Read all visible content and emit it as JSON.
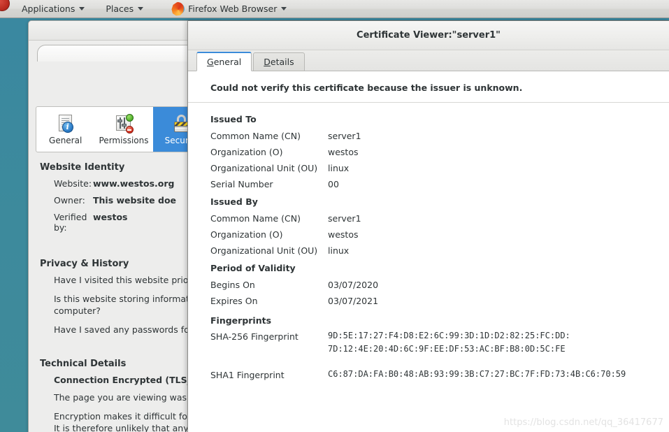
{
  "panel": {
    "applications": "Applications",
    "places": "Places",
    "firefox": "Firefox Web Browser"
  },
  "page_info": {
    "toolbar": [
      {
        "label": "General",
        "icon": "document-info-icon",
        "selected": false
      },
      {
        "label": "Permissions",
        "icon": "permissions-sliders-icon",
        "selected": false
      },
      {
        "label": "Security",
        "icon": "lock-icon",
        "selected": true
      }
    ],
    "website_identity": {
      "heading": "Website Identity",
      "rows": [
        {
          "key": "Website:",
          "value": "www.westos.org"
        },
        {
          "key": "Owner:",
          "value": "This website doe"
        },
        {
          "key": "Verified by:",
          "value": "westos"
        }
      ]
    },
    "privacy_history": {
      "heading": "Privacy & History",
      "lines": [
        "Have I visited this website prior",
        "Is this website storing informat",
        "computer?",
        "Have I saved any passwords for"
      ]
    },
    "technical_details": {
      "heading": "Technical Details",
      "connection": "Connection Encrypted (TLS_E",
      "lines": [
        "The page you are viewing was e",
        "Encryption makes it difficult for",
        "It is therefore unlikely that any"
      ]
    }
  },
  "certificate_viewer": {
    "title": "Certificate Viewer:\"server1\"",
    "tabs": [
      {
        "label": "General",
        "mnemonic": "G",
        "rest": "eneral",
        "active": true
      },
      {
        "label": "Details",
        "mnemonic": "D",
        "rest": "etails",
        "active": false
      }
    ],
    "warning": "Could not verify this certificate because the issuer is unknown.",
    "sections": [
      {
        "heading": "Issued To",
        "fields": [
          {
            "key": "Common Name (CN)",
            "value": "server1"
          },
          {
            "key": "Organization (O)",
            "value": "westos"
          },
          {
            "key": "Organizational Unit (OU)",
            "value": "linux"
          },
          {
            "key": "Serial Number",
            "value": "00"
          }
        ]
      },
      {
        "heading": "Issued By",
        "fields": [
          {
            "key": "Common Name (CN)",
            "value": "server1"
          },
          {
            "key": "Organization (O)",
            "value": "westos"
          },
          {
            "key": "Organizational Unit (OU)",
            "value": "linux"
          }
        ]
      },
      {
        "heading": "Period of Validity",
        "fields": [
          {
            "key": "Begins On",
            "value": "03/07/2020"
          },
          {
            "key": "Expires On",
            "value": "03/07/2021"
          }
        ]
      }
    ],
    "fingerprints": {
      "heading": "Fingerprints",
      "sha256_key": "SHA-256 Fingerprint",
      "sha256_value": "9D:5E:17:27:F4:D8:E2:6C:99:3D:1D:D2:82:25:FC:DD:\n7D:12:4E:20:4D:6C:9F:EE:DF:53:AC:BF:B8:0D:5C:FE",
      "sha1_key": "SHA1 Fingerprint",
      "sha1_value": "C6:87:DA:FA:B0:48:AB:93:99:3B:C7:27:BC:7F:FD:73:4B:C6:70:59"
    }
  },
  "watermark": "https://blog.csdn.net/qq_36417677",
  "colors": {
    "desktop": "#3d8ba0",
    "selection": "#3b8bd9",
    "panel": "#dededc",
    "text": "#2e3436"
  }
}
